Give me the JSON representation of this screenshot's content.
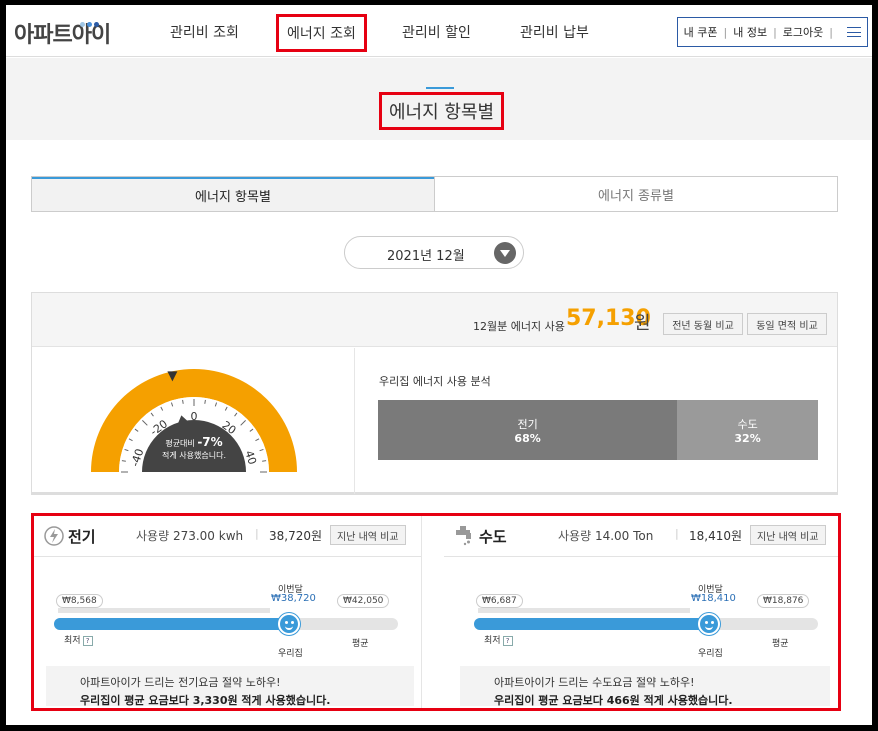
{
  "header": {
    "logo": "아파트아이",
    "logo_dot_colors": [
      "#9fc6e6",
      "#4a90d9",
      "#2b5aa5"
    ],
    "nav": [
      "관리비 조회",
      "에너지 조회",
      "관리비 할인",
      "관리비 납부"
    ],
    "active_nav_index": 1,
    "links": [
      "내 쿠폰",
      "내 정보",
      "로그아웃"
    ],
    "menu_icon": "hamburger-icon"
  },
  "page": {
    "title": "에너지 항목별"
  },
  "tabs": [
    "에너지 항목별",
    "에너지 종류별"
  ],
  "active_tab_index": 0,
  "month": {
    "label": "2021년 12월",
    "dropdown_icon": "chevron-down-circle-icon"
  },
  "summary": {
    "label": "12월분 에너지 사용",
    "amount": "57,130",
    "unit": "원",
    "compare_buttons": [
      "전년 동월 비교",
      "동일 면적 비교"
    ],
    "gauge": {
      "ticks": [
        "-40",
        "-20",
        "0",
        "20",
        "40"
      ],
      "line1_prefix": "평균대비",
      "line1_value": "-7%",
      "line2": "적게 사용했습니다.",
      "value_percent": -7,
      "min": -50,
      "max": 50,
      "color_fill": "#f5a000",
      "color_inner": "#444444"
    },
    "analysis": {
      "title": "우리집 에너지 사용 분석",
      "segments": [
        {
          "name": "전기",
          "percent_label": "68%",
          "percent": 68,
          "color": "#7a7a7a"
        },
        {
          "name": "수도",
          "percent_label": "32%",
          "percent": 32,
          "color": "#9a9a9a"
        }
      ]
    }
  },
  "cards": [
    {
      "icon": "lightning-icon",
      "title": "전기",
      "usage_label": "사용량",
      "usage_value": "273.00 kwh",
      "amount": "38,720원",
      "compare_button": "지난 내역 비교",
      "min_value": "₩8,568",
      "min_label": "최저",
      "help_mark": "?",
      "current_label": "이번달",
      "current_value": "₩38,720",
      "avg_value": "₩42,050",
      "avg_label": "평균",
      "home_label": "우리집",
      "fill_fraction": 0.69,
      "tip_line1": "아파트아이가 드리는 전기요금 절약 노하우!",
      "tip_line2": "우리집이 평균 요금보다 3,330원 적게 사용했습니다."
    },
    {
      "icon": "faucet-icon",
      "title": "수도",
      "usage_label": "사용량",
      "usage_value": "14.00 Ton",
      "amount": "18,410원",
      "compare_button": "지난 내역 비교",
      "min_value": "₩6,687",
      "min_label": "최저",
      "help_mark": "?",
      "current_label": "이번달",
      "current_value": "₩18,410",
      "avg_value": "₩18,876",
      "avg_label": "평균",
      "home_label": "우리집",
      "fill_fraction": 0.69,
      "tip_line1": "아파트아이가 드리는 수도요금 절약 노하우!",
      "tip_line2": "우리집이 평균 요금보다 466원 적게 사용했습니다."
    }
  ]
}
